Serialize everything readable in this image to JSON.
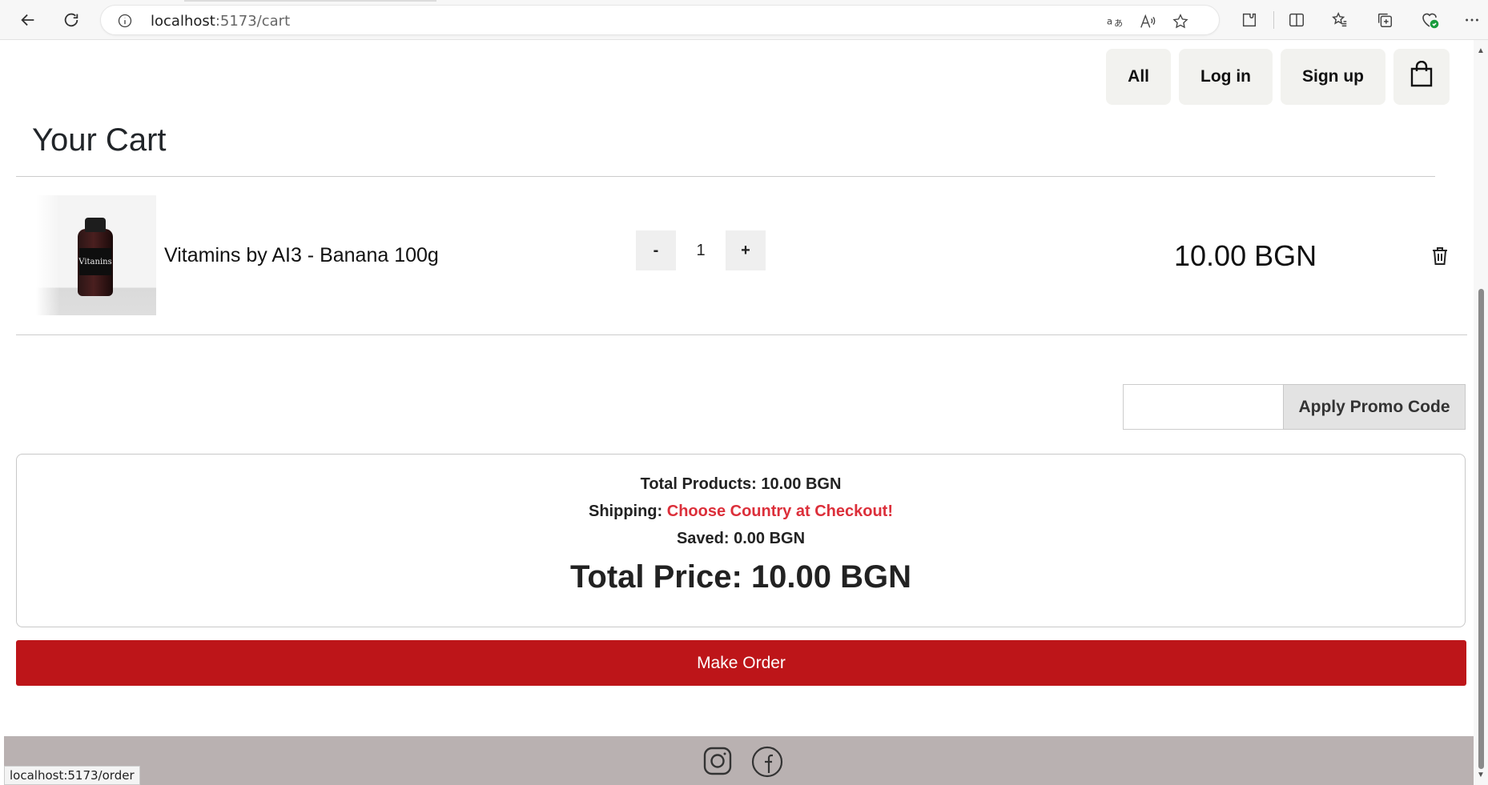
{
  "browser": {
    "url_host": "localhost",
    "url_path": ":5173/cart",
    "status_url": "localhost:5173/order",
    "icons": [
      "back-icon",
      "reload-icon",
      "site-info-icon",
      "translate-icon",
      "read-aloud-icon",
      "favorite-star-icon",
      "extensions-icon",
      "split-screen-icon",
      "favorites-icon",
      "collections-icon",
      "browser-essentials-icon",
      "more-icon"
    ]
  },
  "nav": {
    "all_label": "All",
    "login_label": "Log in",
    "signup_label": "Sign up",
    "bag_icon": "shopping-bag-icon"
  },
  "cart": {
    "title": "Your Cart",
    "items": [
      {
        "name": "Vitamins by AI3 - Banana 100g",
        "image_label": "Vitanins",
        "quantity": "1",
        "decrement_label": "-",
        "increment_label": "+",
        "price": "10.00 BGN"
      }
    ]
  },
  "promo": {
    "input_value": "",
    "button_label": "Apply Promo Code"
  },
  "summary": {
    "total_products_label": "Total Products:",
    "total_products_value": "10.00 BGN",
    "shipping_label": "Shipping:",
    "shipping_value": "Choose Country at Checkout!",
    "saved_label": "Saved:",
    "saved_value": "0.00 BGN",
    "total_price_label": "Total Price:",
    "total_price_value": "10.00 BGN"
  },
  "order_button_label": "Make Order",
  "footer": {
    "icons": [
      "instagram-icon",
      "facebook-icon"
    ]
  },
  "colors": {
    "order_button": "#bd1519",
    "shipping_warning": "#dc2f3a",
    "footer_bg": "#b9b1b1",
    "nav_button_bg": "#f2f2ef"
  }
}
